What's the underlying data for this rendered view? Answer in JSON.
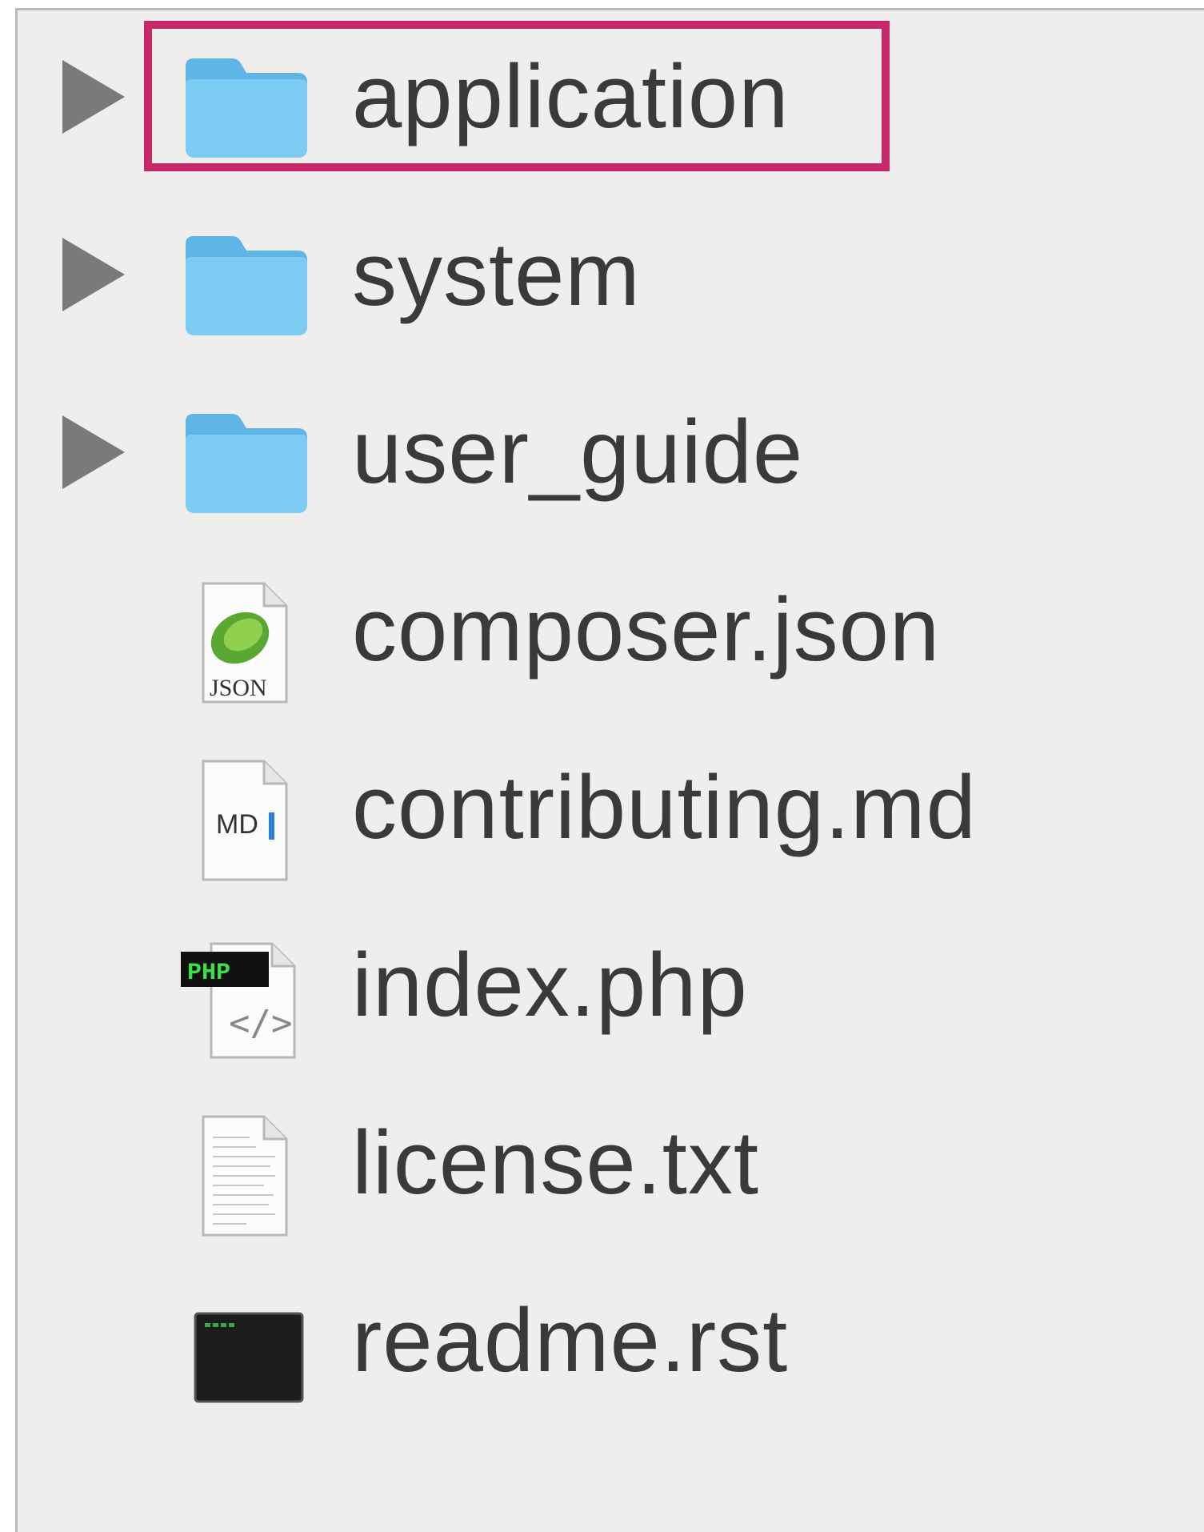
{
  "file_list": {
    "items": [
      {
        "name": "application",
        "kind": "folder",
        "icon": "folder-icon",
        "expandable": true,
        "highlighted": true
      },
      {
        "name": "system",
        "kind": "folder",
        "icon": "folder-icon",
        "expandable": true,
        "highlighted": false
      },
      {
        "name": "user_guide",
        "kind": "folder",
        "icon": "folder-icon",
        "expandable": true,
        "highlighted": false
      },
      {
        "name": "composer.json",
        "kind": "file",
        "icon": "json-file-icon",
        "badge": "JSON",
        "expandable": false,
        "highlighted": false
      },
      {
        "name": "contributing.md",
        "kind": "file",
        "icon": "markdown-file-icon",
        "badge": "MD",
        "expandable": false,
        "highlighted": false
      },
      {
        "name": "index.php",
        "kind": "file",
        "icon": "php-file-icon",
        "badge": "PHP",
        "expandable": false,
        "highlighted": false
      },
      {
        "name": "license.txt",
        "kind": "file",
        "icon": "text-file-icon",
        "expandable": false,
        "highlighted": false
      },
      {
        "name": "readme.rst",
        "kind": "file",
        "icon": "terminal-exec-icon",
        "expandable": false,
        "highlighted": false
      }
    ]
  },
  "colors": {
    "highlight_border": "#c8286a",
    "folder_blue": "#6cc0ec",
    "text": "#3a3a3a",
    "background": "#efeeed"
  }
}
